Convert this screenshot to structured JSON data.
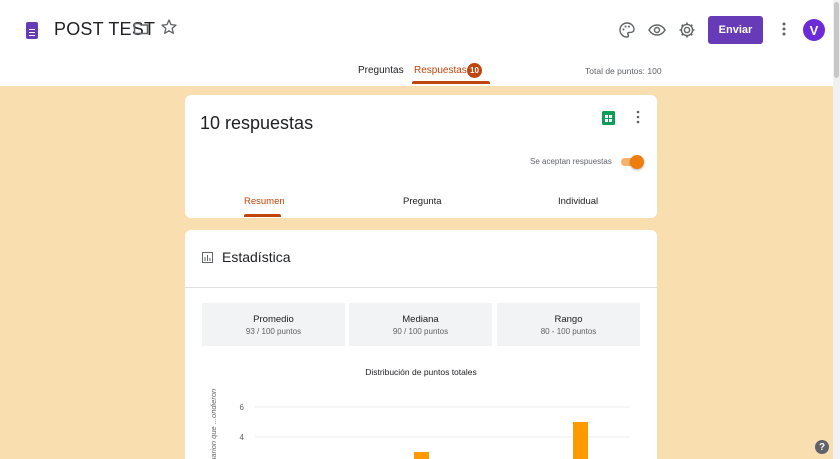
{
  "header": {
    "title": "POST TEST",
    "send_label": "Enviar",
    "avatar_initial": "V",
    "brand_color": "#673ab7",
    "accent_color": "#c0450c"
  },
  "tabs": {
    "questions_label": "Preguntas",
    "responses_label": "Respuestas",
    "responses_badge": "10",
    "total_points": "Total de puntos: 100"
  },
  "responses_card": {
    "count_label": "10 respuestas",
    "accepting_label": "Se aceptan respuestas",
    "accepting": true,
    "subtabs": [
      "Resumen",
      "Pregunta",
      "Individual"
    ],
    "active_subtab": "Resumen"
  },
  "stats_card": {
    "title": "Estadística",
    "boxes": [
      {
        "label": "Promedio",
        "value": "93 / 100 puntos"
      },
      {
        "label": "Mediana",
        "value": "90 / 100 puntos"
      },
      {
        "label": "Rango",
        "value": "80 - 100 puntos"
      }
    ],
    "distribution_title": "Distribución de puntos totales"
  },
  "chart_data": {
    "type": "bar",
    "title": "Distribución de puntos totales",
    "ylabel": "...uarion que ...ondieron",
    "y_ticks": [
      "6",
      "4"
    ],
    "ylim": [
      0,
      6
    ],
    "series": [
      {
        "values": [
          3,
          5
        ]
      }
    ],
    "bar_color": "#ff9900"
  },
  "help": {
    "label": "?"
  }
}
